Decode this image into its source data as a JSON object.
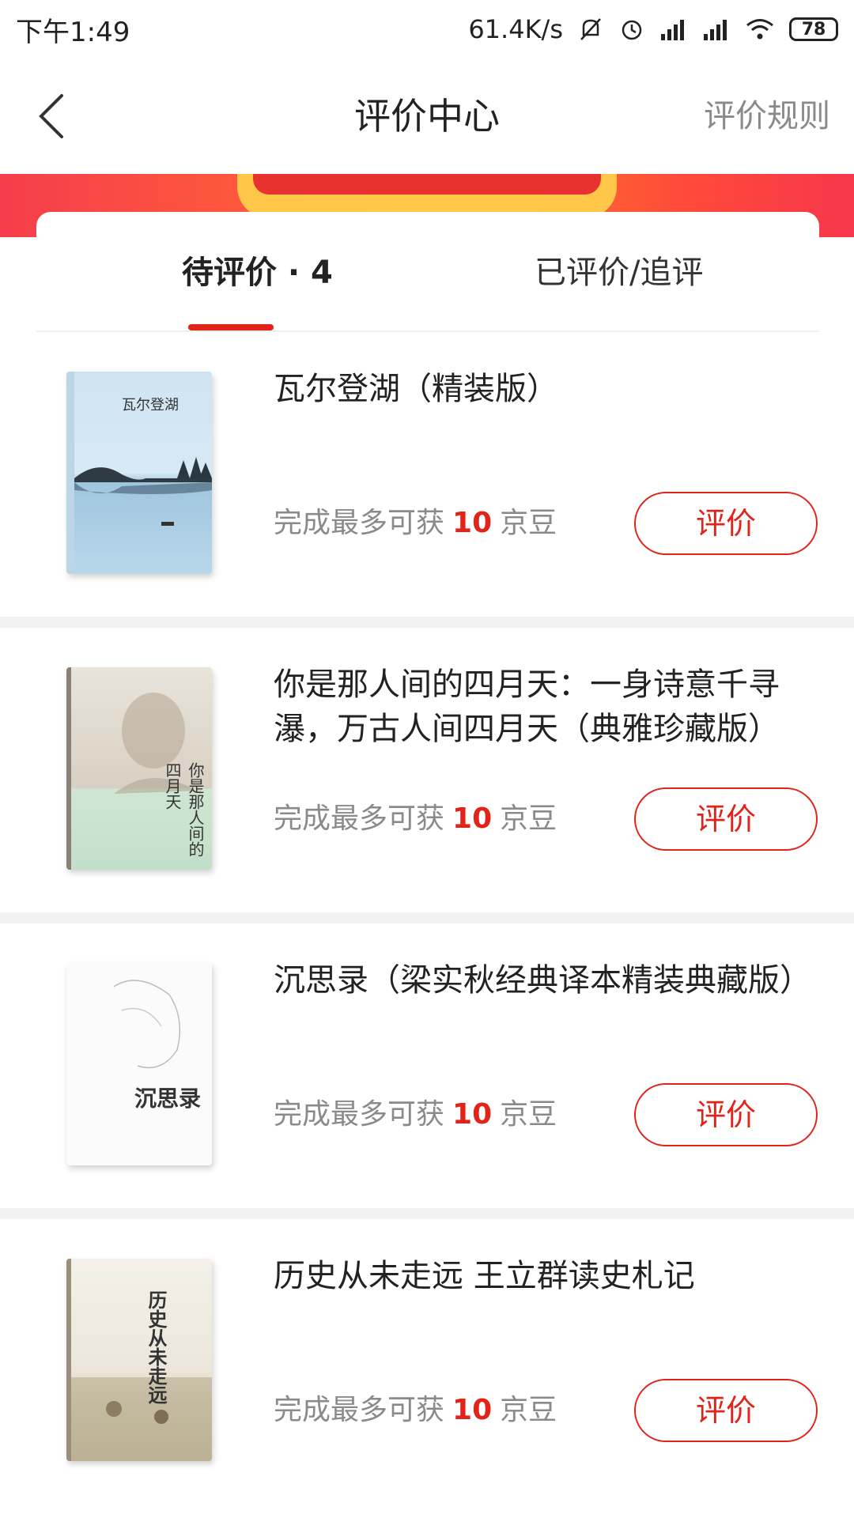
{
  "status_bar": {
    "time": "下午1:49",
    "speed": "61.4K/s",
    "icons": [
      "mute-icon",
      "alarm-icon",
      "signal-icon",
      "signal-icon",
      "wifi-icon"
    ],
    "battery": "78"
  },
  "nav": {
    "title": "评价中心",
    "rule_label": "评价规则",
    "back_icon": "chevron-left-icon"
  },
  "tabs": {
    "pending_label": "待评价 · 4",
    "done_label": "已评价/追评"
  },
  "accent_color": "#e2231a",
  "items": [
    {
      "title": "瓦尔登湖（精装版）",
      "reward_prefix": "完成最多可获",
      "reward_value": "10",
      "reward_unit": "京豆",
      "button_label": "评价",
      "cover_title": "瓦尔登湖"
    },
    {
      "title": "你是那人间的四月天：一身诗意千寻瀑，万古人间四月天（典雅珍藏版）",
      "reward_prefix": "完成最多可获",
      "reward_value": "10",
      "reward_unit": "京豆",
      "button_label": "评价",
      "cover_title": "你是那人间的四月天"
    },
    {
      "title": "沉思录（梁实秋经典译本精装典藏版）",
      "reward_prefix": "完成最多可获",
      "reward_value": "10",
      "reward_unit": "京豆",
      "button_label": "评价",
      "cover_title": "沉思录"
    },
    {
      "title": "历史从未走远 王立群读史札记",
      "reward_prefix": "完成最多可获",
      "reward_value": "10",
      "reward_unit": "京豆",
      "button_label": "评价",
      "cover_title": "历史从未走远"
    }
  ]
}
